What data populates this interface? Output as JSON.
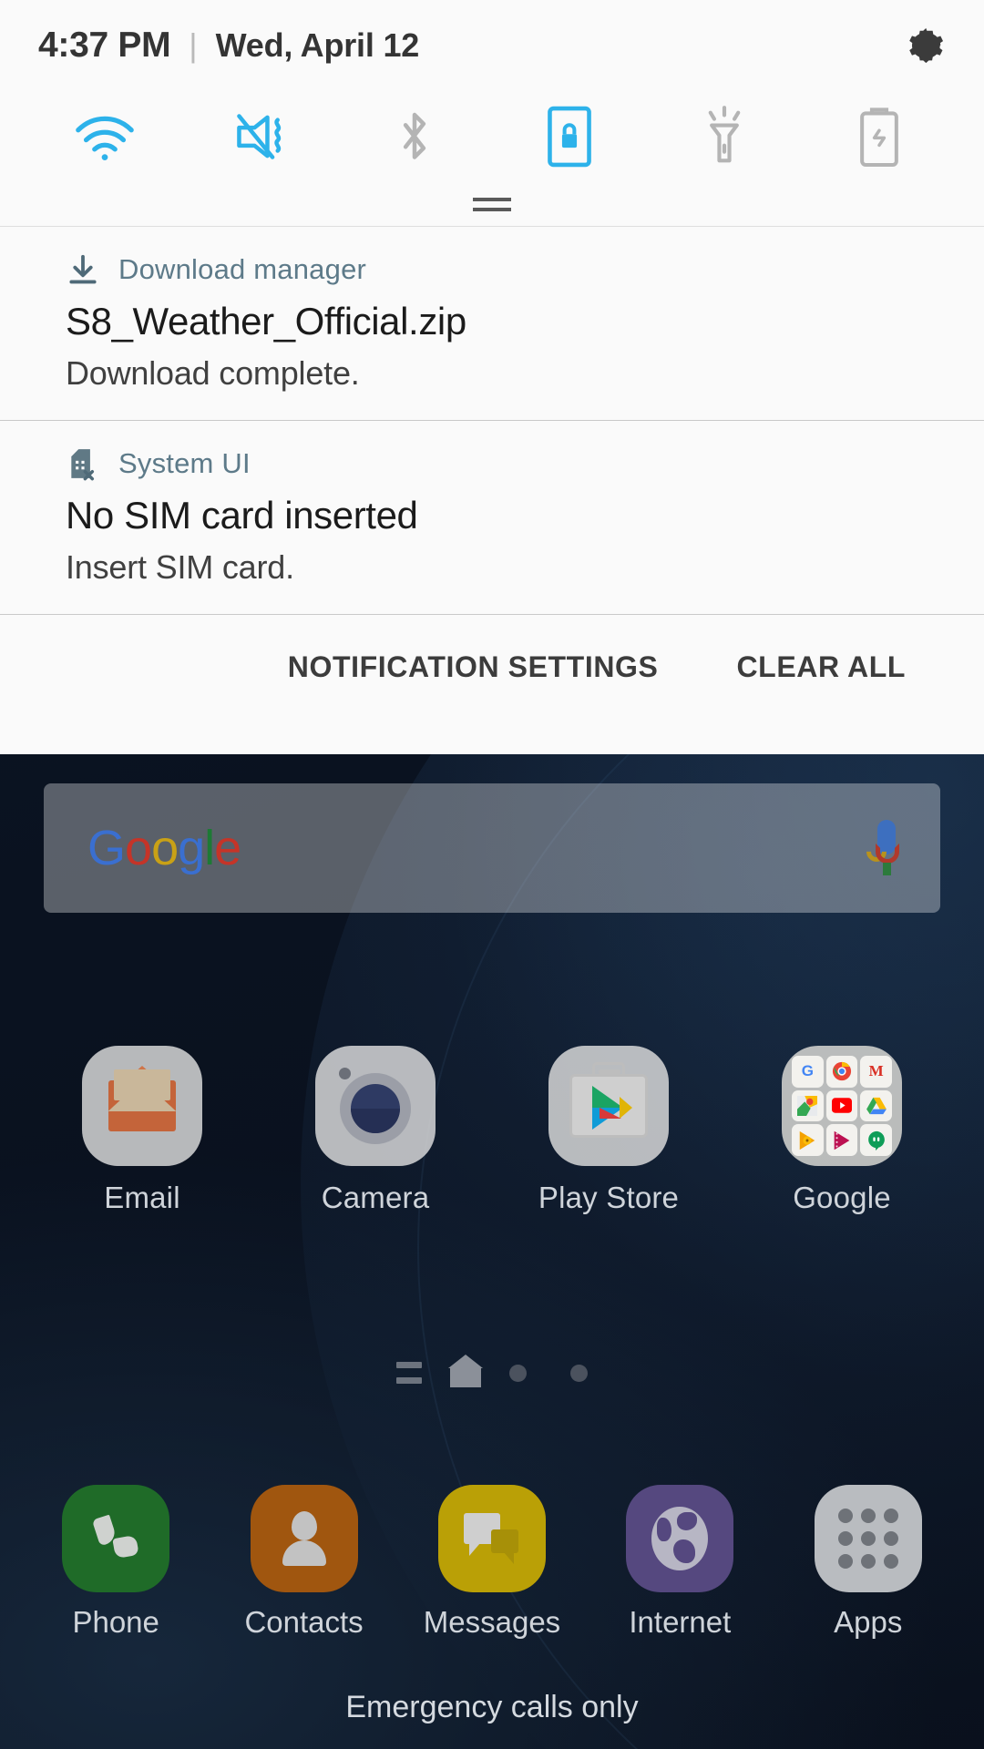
{
  "statusbar": {
    "time": "4:37 PM",
    "separator": "|",
    "date": "Wed, April 12",
    "settings_icon": "gear-icon"
  },
  "quick_settings": {
    "toggles": [
      {
        "name": "wifi",
        "icon": "wifi-icon",
        "label": "Wi-Fi",
        "state": "on",
        "color": "#2db2ea"
      },
      {
        "name": "sound",
        "icon": "mute-vibrate-icon",
        "label": "Vibrate",
        "state": "on",
        "color": "#2db2ea"
      },
      {
        "name": "bluetooth",
        "icon": "bluetooth-icon",
        "label": "Bluetooth",
        "state": "off",
        "color": "#b4b4b4"
      },
      {
        "name": "auto-rotate",
        "icon": "rotation-lock-icon",
        "label": "Auto rotate",
        "state": "on",
        "color": "#2db2ea"
      },
      {
        "name": "flashlight",
        "icon": "flashlight-icon",
        "label": "Flashlight",
        "state": "off",
        "color": "#b4b4b4"
      },
      {
        "name": "power-saving",
        "icon": "power-saving-icon",
        "label": "Power saving",
        "state": "off",
        "color": "#b4b4b4"
      }
    ]
  },
  "notifications": [
    {
      "app": "Download manager",
      "icon": "download-icon",
      "title": "S8_Weather_Official.zip",
      "body": "Download complete."
    },
    {
      "app": "System UI",
      "icon": "sim-card-error-icon",
      "title": "No SIM card inserted",
      "body": "Insert SIM card."
    }
  ],
  "notification_footer": {
    "settings_label": "NOTIFICATION SETTINGS",
    "clear_label": "CLEAR ALL"
  },
  "home": {
    "search_widget": {
      "logo_letters": [
        "G",
        "o",
        "o",
        "g",
        "l",
        "e"
      ],
      "mic_icon": "microphone-icon"
    },
    "apps": [
      {
        "label": "Email",
        "icon": "email-icon"
      },
      {
        "label": "Camera",
        "icon": "camera-icon"
      },
      {
        "label": "Play Store",
        "icon": "play-store-icon"
      },
      {
        "label": "Google",
        "icon": "google-folder-icon"
      }
    ],
    "google_folder": [
      {
        "name": "google",
        "glyph": "G",
        "color": "#4285f4"
      },
      {
        "name": "chrome",
        "glyph": "",
        "color": "#34a853"
      },
      {
        "name": "gmail",
        "glyph": "M",
        "color": "#d93025"
      },
      {
        "name": "maps",
        "glyph": "",
        "color": "#34a853"
      },
      {
        "name": "youtube",
        "glyph": "",
        "color": "#ff0000"
      },
      {
        "name": "drive",
        "glyph": "",
        "color": "#ffc107"
      },
      {
        "name": "play-music",
        "glyph": "",
        "color": "#ff9800"
      },
      {
        "name": "play-movies",
        "glyph": "",
        "color": "#c2185b"
      },
      {
        "name": "hangouts",
        "glyph": "",
        "color": "#0f9d58"
      }
    ],
    "page_indicators": [
      {
        "type": "feed",
        "active": false
      },
      {
        "type": "home",
        "active": true
      },
      {
        "type": "dot",
        "active": false
      },
      {
        "type": "dot",
        "active": false
      }
    ],
    "dock": [
      {
        "label": "Phone",
        "icon": "phone-icon",
        "color": "#1f6b28"
      },
      {
        "label": "Contacts",
        "icon": "contacts-icon",
        "color": "#a0560f"
      },
      {
        "label": "Messages",
        "icon": "messages-icon",
        "color": "#baa006"
      },
      {
        "label": "Internet",
        "icon": "internet-icon",
        "color": "#55487f"
      },
      {
        "label": "Apps",
        "icon": "apps-grid-icon",
        "color": "#b9bcc0"
      }
    ],
    "status_text": "Emergency calls only"
  }
}
